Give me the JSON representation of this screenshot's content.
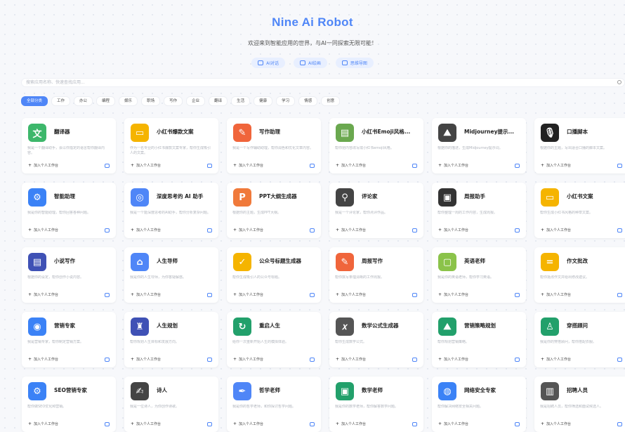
{
  "header": {
    "title": "Nine Ai Robot",
    "subtitle": "欢迎来到智能应用的世界，与AI一同探索无限可能！"
  },
  "actions": [
    {
      "label": "AI对话",
      "icon": "chat-icon"
    },
    {
      "label": "AI绘画",
      "icon": "pen-icon"
    },
    {
      "label": "思维导图",
      "icon": "share-icon"
    }
  ],
  "search": {
    "placeholder": "搜索应用名称、快速查找应用..."
  },
  "tags": [
    "全部分类",
    "工作",
    "办公",
    "编程",
    "娱乐",
    "职场",
    "写作",
    "企业",
    "翻译",
    "生活",
    "健康",
    "学习",
    "情感",
    "创意"
  ],
  "active_tag_index": 0,
  "cards": [
    {
      "name": "翻译器",
      "desc": "我是一个翻译助手，会以你指定的语言帮你翻译内容。",
      "meta": "加入个人工作台",
      "color": "#3db76b",
      "glyph": "文"
    },
    {
      "name": "小红书爆款文案",
      "desc": "作为一名专业的小红书爆款文案专家，帮你生成吸引人的文案。",
      "meta": "加入个人工作台",
      "color": "#f5b400",
      "glyph": "▭"
    },
    {
      "name": "写作助理",
      "desc": "我是一个写作辅助助理，帮你润色和优化文章内容。",
      "meta": "加入个人工作台",
      "color": "#f0653b",
      "glyph": "✎"
    },
    {
      "name": "小红书Emoji风格...",
      "desc": "帮你把内容改写成小红书emoji风格。",
      "meta": "加入个人工作台",
      "color": "#6aa84f",
      "glyph": "▤"
    },
    {
      "name": "Midjourney提示...",
      "desc": "根据你的描述，生成Midjourney提示词。",
      "meta": "加入个人工作台",
      "color": "#444",
      "glyph": "⛰"
    },
    {
      "name": "口播脚本",
      "desc": "根据你的主题，写出适合口播的脚本文案。",
      "meta": "加入个人工作台",
      "color": "#222",
      "glyph": "🎙"
    },
    {
      "name": "智能助理",
      "desc": "我是你的智能助理，帮你回答各种问题。",
      "meta": "加入个人工作台",
      "color": "#3b82f6",
      "glyph": "⚙"
    },
    {
      "name": "深度思考的 AI 助手",
      "desc": "我是一个能深度思考的AI助手，帮你分析复杂问题。",
      "meta": "加入个人工作台",
      "color": "#4f86f7",
      "glyph": "◎"
    },
    {
      "name": "PPT大纲生成器",
      "desc": "根据你的主题，生成PPT大纲。",
      "meta": "加入个人工作台",
      "color": "#f07a3b",
      "glyph": "P"
    },
    {
      "name": "评论家",
      "desc": "我是一个评论家，帮你点评作品。",
      "meta": "加入个人工作台",
      "color": "#444",
      "glyph": "⚲"
    },
    {
      "name": "周报助手",
      "desc": "帮你整理一周的工作内容，生成周报。",
      "meta": "加入个人工作台",
      "color": "#333",
      "glyph": "▣"
    },
    {
      "name": "小红书文案",
      "desc": "帮你生成小红书风格的种草文案。",
      "meta": "加入个人工作台",
      "color": "#f5b400",
      "glyph": "▭"
    },
    {
      "name": "小说写作",
      "desc": "根据你的设定，帮你创作小说内容。",
      "meta": "加入个人工作台",
      "color": "#3f51b5",
      "glyph": "▤"
    },
    {
      "name": "人生导师",
      "desc": "我是你的人生导师，为你答疑解惑。",
      "meta": "加入个人工作台",
      "color": "#4f86f7",
      "glyph": "⌂"
    },
    {
      "name": "公众号标题生成器",
      "desc": "帮你生成吸引人的公众号标题。",
      "meta": "加入个人工作台",
      "color": "#f5b400",
      "glyph": "✓"
    },
    {
      "name": "周报写作",
      "desc": "帮你撰写条理清晰的工作周报。",
      "meta": "加入个人工作台",
      "color": "#f0653b",
      "glyph": "✎"
    },
    {
      "name": "英语老师",
      "desc": "我是你的英语老师，帮你学习英语。",
      "meta": "加入个人工作台",
      "color": "#8bc34a",
      "glyph": "▢"
    },
    {
      "name": "作文批改",
      "desc": "帮你批改作文并给出修改建议。",
      "meta": "加入个人工作台",
      "color": "#f5b400",
      "glyph": "="
    },
    {
      "name": "营销专家",
      "desc": "我是营销专家，帮你制定营销方案。",
      "meta": "加入个人工作台",
      "color": "#3b82f6",
      "glyph": "◉"
    },
    {
      "name": "人生规划",
      "desc": "帮你规划人生目标和发展方向。",
      "meta": "加入个人工作台",
      "color": "#3f51b5",
      "glyph": "♜"
    },
    {
      "name": "重启人生",
      "desc": "给你一次重新开始人生的模拟体验。",
      "meta": "加入个人工作台",
      "color": "#22a06b",
      "glyph": "↻"
    },
    {
      "name": "数学公式生成器",
      "desc": "帮你生成数学公式。",
      "meta": "加入个人工作台",
      "color": "#555",
      "glyph": "𝑥"
    },
    {
      "name": "营销策略规划",
      "desc": "帮你规划营销策略。",
      "meta": "加入个人工作台",
      "color": "#22a06b",
      "glyph": "⛰"
    },
    {
      "name": "穿搭顾问",
      "desc": "我是你的穿搭顾问，帮你搭配衣服。",
      "meta": "加入个人工作台",
      "color": "#22a06b",
      "glyph": "♙"
    },
    {
      "name": "SEO营销专家",
      "desc": "帮你做SEO优化和营销。",
      "meta": "加入个人工作台",
      "color": "#3b82f6",
      "glyph": "⚙"
    },
    {
      "name": "诗人",
      "desc": "我是一位诗人，为你创作诗歌。",
      "meta": "加入个人工作台",
      "color": "#444",
      "glyph": "✍"
    },
    {
      "name": "哲学老师",
      "desc": "我是你的哲学老师，和你探讨哲学问题。",
      "meta": "加入个人工作台",
      "color": "#4f86f7",
      "glyph": "✒"
    },
    {
      "name": "数学老师",
      "desc": "我是你的数学老师，帮你解答数学问题。",
      "meta": "加入个人工作台",
      "color": "#22a06b",
      "glyph": "▣"
    },
    {
      "name": "网络安全专家",
      "desc": "帮你解决网络安全相关问题。",
      "meta": "加入个人工作台",
      "color": "#3b82f6",
      "glyph": "◍"
    },
    {
      "name": "招聘人员",
      "desc": "我是招聘人员，帮你筛选和面试候选人。",
      "meta": "加入个人工作台",
      "color": "#555",
      "glyph": "▥"
    }
  ]
}
